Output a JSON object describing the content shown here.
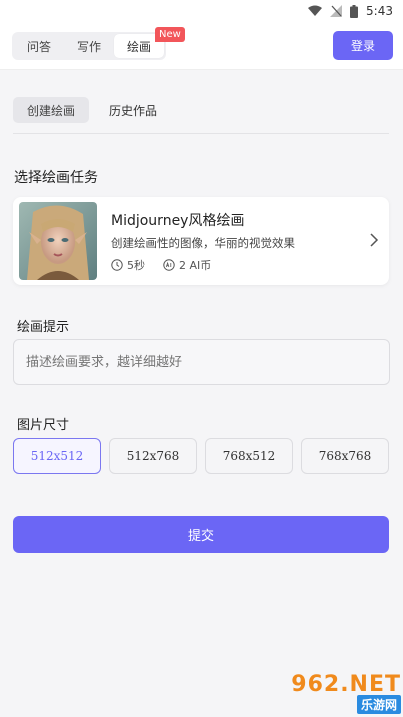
{
  "status_bar": {
    "time": "5:43"
  },
  "header": {
    "tabs": [
      {
        "label": "问答",
        "active": false
      },
      {
        "label": "写作",
        "active": false
      },
      {
        "label": "绘画",
        "active": true
      }
    ],
    "badge": "New",
    "login_label": "登录"
  },
  "subtabs": [
    {
      "label": "创建绘画",
      "active": true
    },
    {
      "label": "历史作品",
      "active": false
    }
  ],
  "task_section": {
    "title": "选择绘画任务",
    "card": {
      "title": "Midjourney风格绘画",
      "description": "创建绘画性的图像，华丽的视觉效果",
      "duration": "5秒",
      "cost": "2 AI币"
    }
  },
  "prompt": {
    "label": "绘画提示",
    "placeholder": "描述绘画要求，越详细越好"
  },
  "size": {
    "label": "图片尺寸",
    "options": [
      "512x512",
      "512x768",
      "768x512",
      "768x768"
    ],
    "selected": "512x512"
  },
  "submit_label": "提交",
  "colors": {
    "accent": "#6b66f5",
    "badge": "#f2565a"
  }
}
